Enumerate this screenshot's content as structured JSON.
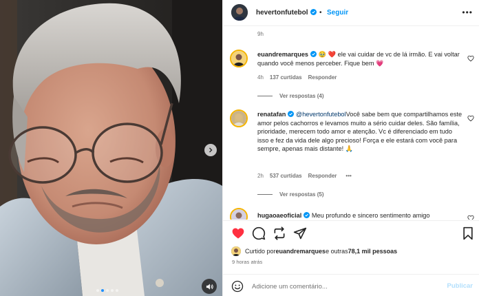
{
  "post": {
    "author": "hevertonfutebol",
    "follow_label": "Seguir",
    "more_label": "•••",
    "caption_time": "9h",
    "likes_prefix": "Curtido por ",
    "likes_user": "euandremarques",
    "likes_middle": " e outras ",
    "likes_count": "78,1 mil pessoas",
    "time_ago": "9 horas atrás",
    "carousel": {
      "slides": 5,
      "active_index": 1
    }
  },
  "comments": [
    {
      "user": "euandremarques",
      "verified": true,
      "text": " ele vai cuidar de vc de lá irmão. E vai voltar quando você menos perceber. Fique bem ",
      "emoji_lead": "🥹 ❤️",
      "emoji_tail": "💗",
      "time": "4h",
      "likes": "137 curtidas",
      "reply_label": "Responder",
      "view_replies": "Ver respostas (4)"
    },
    {
      "user": "renatafan",
      "verified": true,
      "mention": "@hevertonfutebol",
      "text": "Você sabe bem que compartilhamos este amor pelos cachorros e levamos muito a sério cuidar deles. São família, prioridade, merecem todo amor e atenção. Vc é diferenciado em tudo isso e fez da vida dele algo precioso! Força e ele estará com você para sempre, apenas mais distante! ",
      "emoji_tail": "🙏",
      "time": "2h",
      "likes": "537 curtidas",
      "reply_label": "Responder",
      "more_label": "•••",
      "view_replies": "Ver respostas (5)"
    },
    {
      "user": "hugaoaeoficial",
      "verified": true,
      "text": "Meu profundo e sincero sentimento amigo"
    }
  ],
  "add_comment": {
    "placeholder": "Adicione um comentário...",
    "publish_label": "Publicar"
  },
  "colors": {
    "accent_blue": "#0095f6",
    "like_red": "#ff3040",
    "publish_disabled": "#b2dffc",
    "verified_blue": "#0095f6"
  },
  "icons": {
    "like": "heart-filled-icon",
    "comment": "comment-bubble-icon",
    "share": "repost-icon",
    "send": "paper-plane-icon",
    "save": "bookmark-icon",
    "emoji": "smiley-icon",
    "sound": "speaker-icon",
    "next": "chevron-right-icon"
  }
}
